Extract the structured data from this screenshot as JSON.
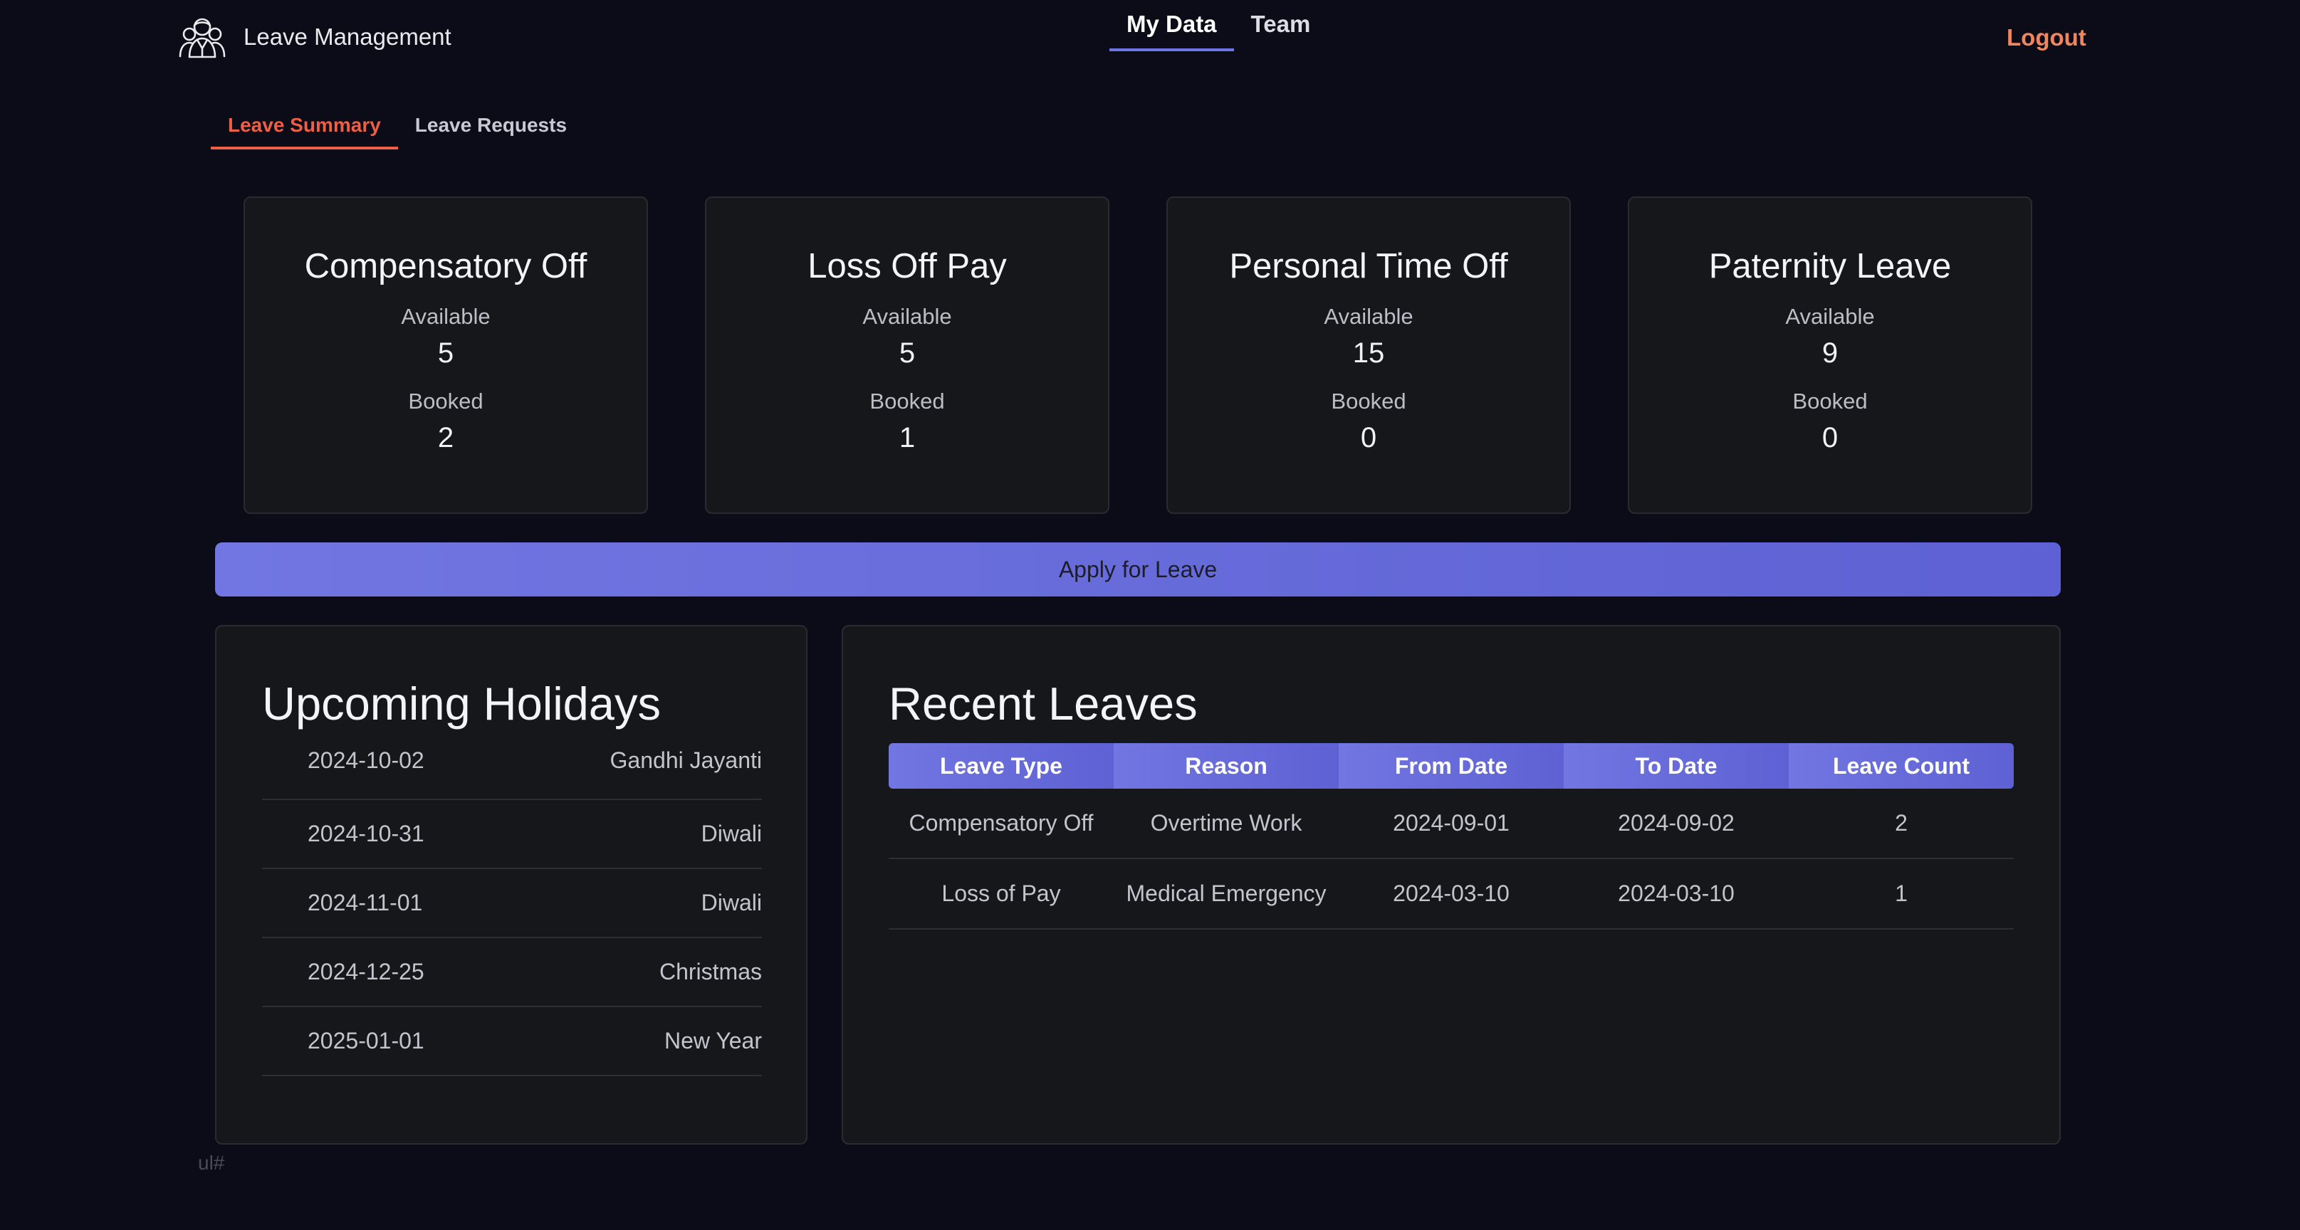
{
  "header": {
    "app_title": "Leave Management",
    "tabs": [
      {
        "label": "My Data",
        "active": true
      },
      {
        "label": "Team",
        "active": false
      }
    ],
    "logout_label": "Logout"
  },
  "sub_tabs": [
    {
      "label": "Leave Summary",
      "active": true
    },
    {
      "label": "Leave Requests",
      "active": false
    }
  ],
  "summary": {
    "available_label": "Available",
    "booked_label": "Booked",
    "cards": [
      {
        "title": "Compensatory Off",
        "available": "5",
        "booked": "2"
      },
      {
        "title": "Loss Off Pay",
        "available": "5",
        "booked": "1"
      },
      {
        "title": "Personal Time Off",
        "available": "15",
        "booked": "0"
      },
      {
        "title": "Paternity Leave",
        "available": "9",
        "booked": "0"
      }
    ]
  },
  "apply_button_label": "Apply for Leave",
  "holidays": {
    "title": "Upcoming Holidays",
    "items": [
      {
        "date": "2024-10-02",
        "name": "Gandhi Jayanti"
      },
      {
        "date": "2024-10-31",
        "name": "Diwali"
      },
      {
        "date": "2024-11-01",
        "name": "Diwali"
      },
      {
        "date": "2024-12-25",
        "name": "Christmas"
      },
      {
        "date": "2025-01-01",
        "name": "New Year"
      }
    ]
  },
  "recent_leaves": {
    "title": "Recent Leaves",
    "columns": [
      "Leave Type",
      "Reason",
      "From Date",
      "To Date",
      "Leave Count"
    ],
    "rows": [
      [
        "Compensatory Off",
        "Overtime Work",
        "2024-09-01",
        "2024-09-02",
        "2"
      ],
      [
        "Loss of Pay",
        "Medical Emergency",
        "2024-03-10",
        "2024-03-10",
        "1"
      ]
    ]
  },
  "footer_text": "ul#",
  "colors": {
    "background": "#0b0c17",
    "accent": "#6f75e4",
    "active_subtab": "#ef5f45",
    "logout": "#f0865f",
    "card_background": "#16171b"
  },
  "icons": {
    "brand": "team-people-icon"
  }
}
